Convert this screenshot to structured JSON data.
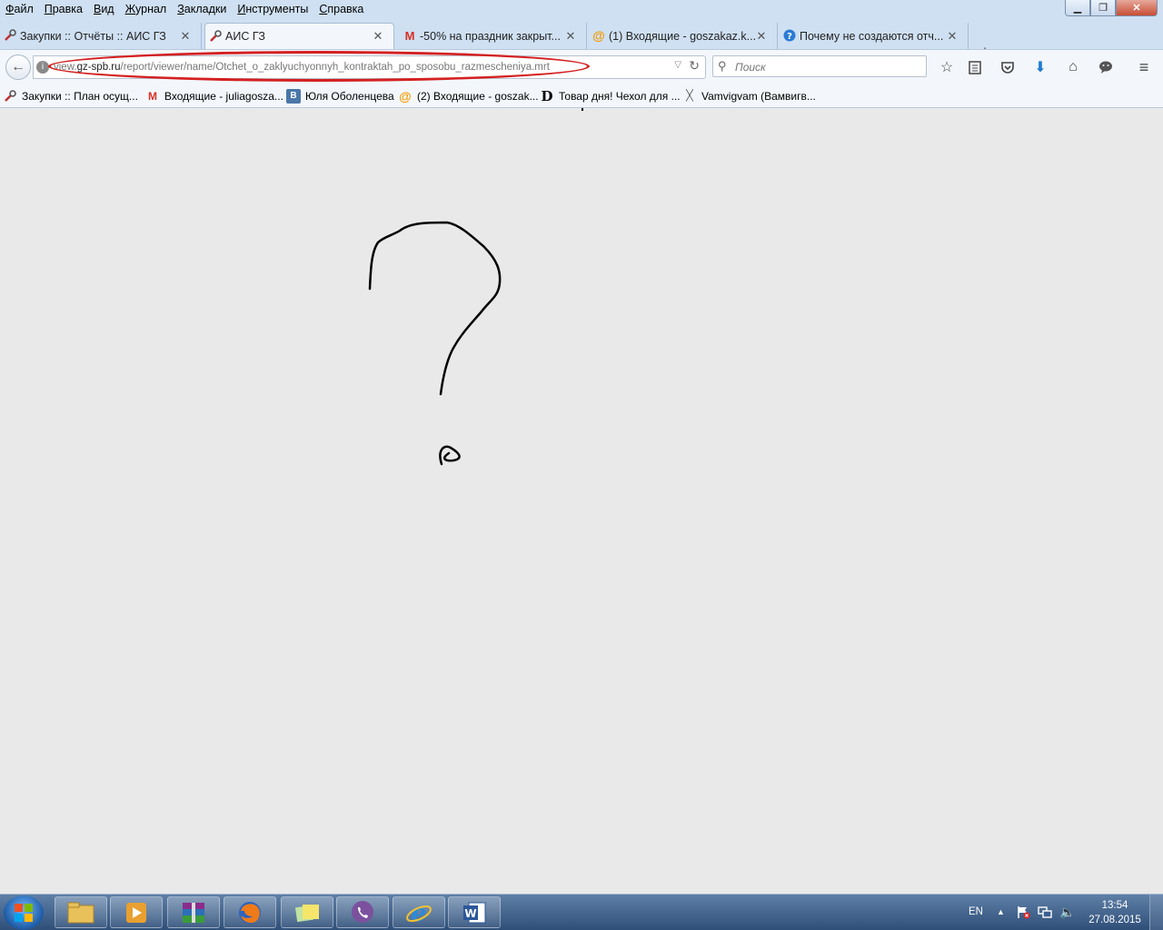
{
  "menu": [
    "Файл",
    "Правка",
    "Вид",
    "Журнал",
    "Закладки",
    "Инструменты",
    "Справка"
  ],
  "tabs": [
    {
      "label": "Закупки :: Отчёты :: АИС ГЗ",
      "icon": "tools-icon"
    },
    {
      "label": "АИС ГЗ",
      "icon": "tools-icon"
    },
    {
      "label": "-50% на праздник закрыт...",
      "icon": "gmail-icon"
    },
    {
      "label": "(1) Входящие - goszakaz.k...",
      "icon": "mailru-icon"
    },
    {
      "label": "Почему не создаются отч...",
      "icon": "help-icon"
    }
  ],
  "url": {
    "prefix": "view.",
    "host": "gz-spb.ru",
    "path": "/report/viewer/name/Otchet_o_zaklyuchyonnyh_kontraktah_po_sposobu_razmescheniya.mrt"
  },
  "search": {
    "placeholder": "Поиск"
  },
  "bookmarks": [
    {
      "label": "Закупки :: План осущ...",
      "icon": "tools-icon"
    },
    {
      "label": "Входящие - juliagosza...",
      "icon": "gmail-icon"
    },
    {
      "label": "Юля Оболенцева",
      "icon": "vk-icon"
    },
    {
      "label": "(2) Входящие - goszak...",
      "icon": "mailru-icon"
    },
    {
      "label": "Товар дня! Чехол для ...",
      "icon": "d-icon"
    },
    {
      "label": "Vamvigvam (Вамвигв...",
      "icon": "x-icon"
    }
  ],
  "taskbar": {
    "lang": "EN",
    "time": "13:54",
    "date": "27.08.2015"
  },
  "colors": {
    "annotation": "#d42020",
    "accent": "#1c5aa3"
  }
}
